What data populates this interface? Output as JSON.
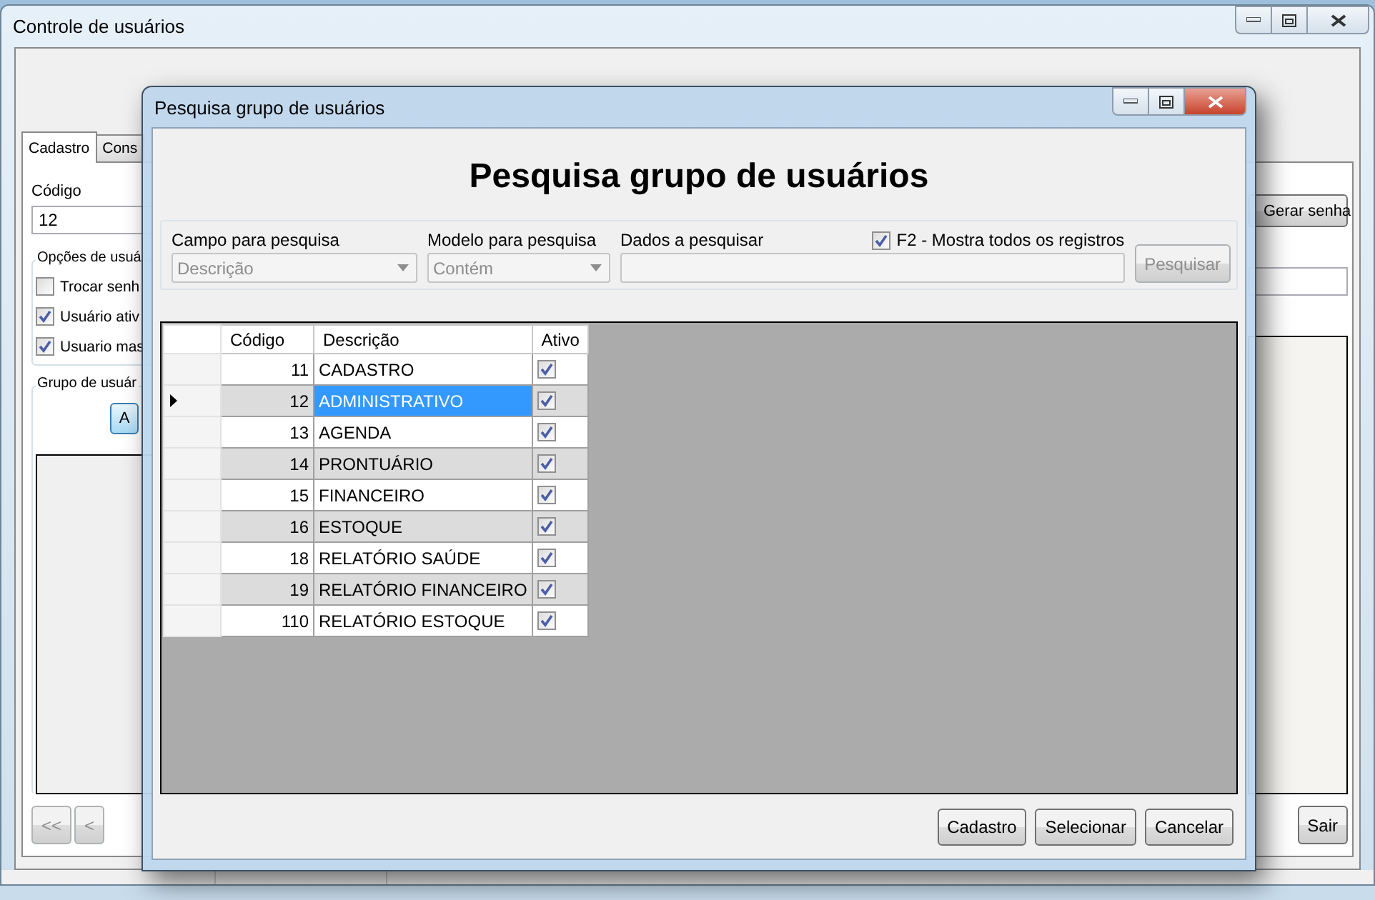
{
  "background_window": {
    "title": "Controle de usuários",
    "tabs": [
      {
        "label": "Cadastro",
        "selected": true
      },
      {
        "label": "Cons",
        "selected": false
      }
    ],
    "code_label": "Código",
    "code_value": "12",
    "options_group": {
      "title": "Opções de usuá",
      "checkboxes": [
        {
          "label": "Trocar senh",
          "checked": false
        },
        {
          "label": "Usuário ativ",
          "checked": true
        },
        {
          "label": "Usuario mas",
          "checked": true
        }
      ]
    },
    "group_box": {
      "title": "Grupo de usuár",
      "button": "A"
    },
    "side_button": "Gerar senha",
    "nav_buttons": [
      "<<",
      "<"
    ],
    "exit_button": "Sair"
  },
  "dialog": {
    "title": "Pesquisa grupo de usuários",
    "heading": "Pesquisa grupo de usuários",
    "search_field": {
      "label": "Campo para pesquisa",
      "value": "Descrição"
    },
    "search_mode": {
      "label": "Modelo para pesquisa",
      "value": "Contém"
    },
    "search_data": {
      "label": "Dados a pesquisar"
    },
    "show_all": {
      "label": "F2 - Mostra todos os registros",
      "checked": true
    },
    "search_button": {
      "label": "Pesquisar",
      "disabled": true
    },
    "grid": {
      "columns": [
        "Código",
        "Descrição",
        "Ativo"
      ],
      "rows": [
        {
          "code": "11",
          "description": "CADASTRO",
          "active": true,
          "selected": false
        },
        {
          "code": "12",
          "description": "ADMINISTRATIVO",
          "active": true,
          "selected": true
        },
        {
          "code": "13",
          "description": "AGENDA",
          "active": true,
          "selected": false
        },
        {
          "code": "14",
          "description": "PRONTUÁRIO",
          "active": true,
          "selected": false
        },
        {
          "code": "15",
          "description": "FINANCEIRO",
          "active": true,
          "selected": false
        },
        {
          "code": "16",
          "description": "ESTOQUE",
          "active": true,
          "selected": false
        },
        {
          "code": "18",
          "description": "RELATÓRIO SAÚDE",
          "active": true,
          "selected": false
        },
        {
          "code": "19",
          "description": "RELATÓRIO FINANCEIRO",
          "active": true,
          "selected": false
        },
        {
          "code": "110",
          "description": "RELATÓRIO ESTOQUE",
          "active": true,
          "selected": false
        }
      ]
    },
    "buttons": [
      "Cadastro",
      "Selecionar",
      "Cancelar"
    ]
  }
}
